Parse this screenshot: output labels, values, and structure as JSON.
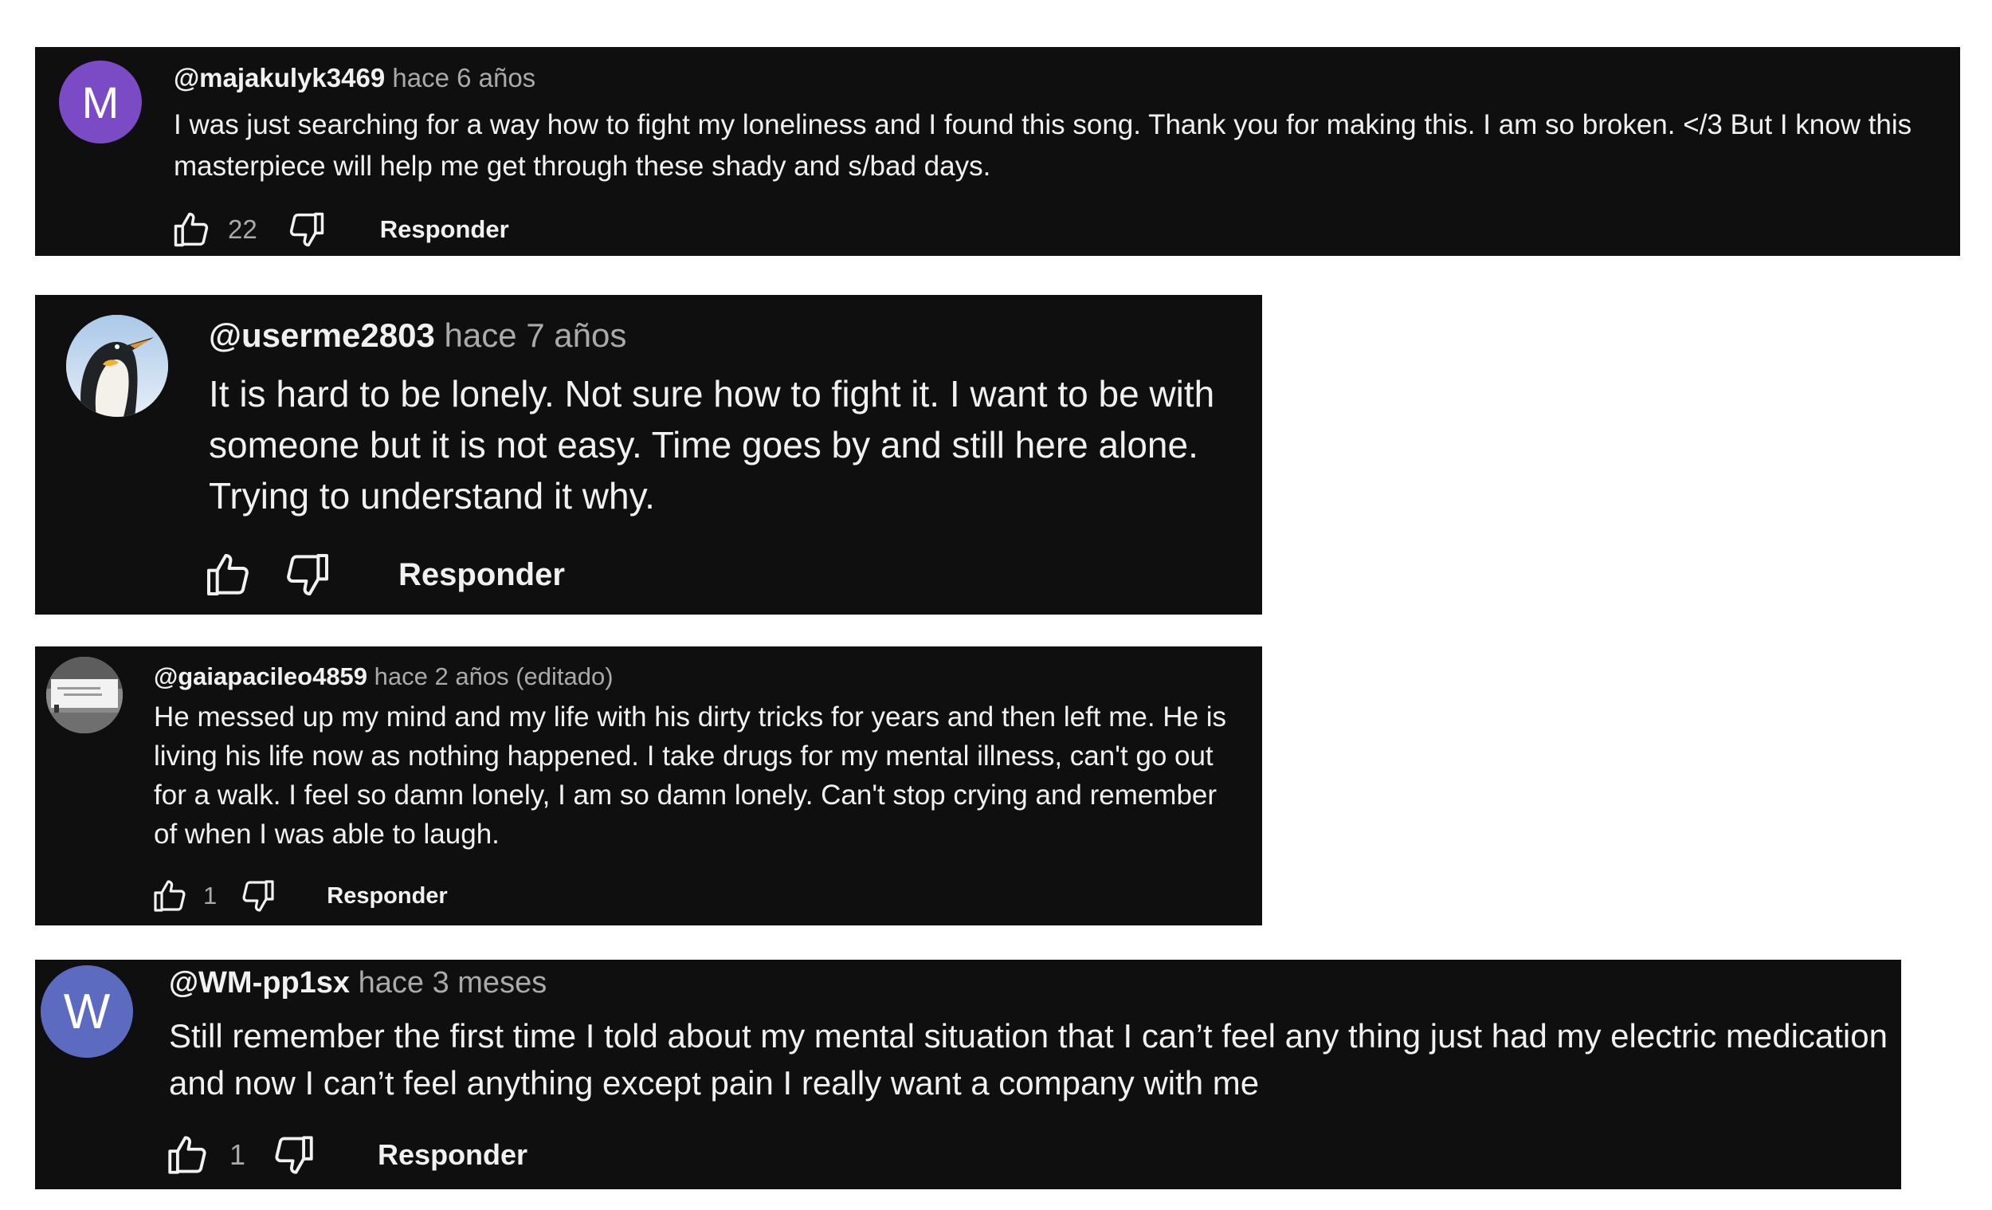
{
  "comments": [
    {
      "avatar_letter": "M",
      "avatar_color": "#7b4bc6",
      "author": "@majakulyk3469",
      "time": "hace 6 años",
      "text": "I was just searching for a way how to fight my loneliness and I found this song. Thank you for making this. I am so broken. </3 But I know this masterpiece will help me get through these shady and s/bad days.",
      "likes": "22",
      "reply_label": "Responder"
    },
    {
      "avatar_icon": "penguin-avatar",
      "author": "@userme2803",
      "time": "hace 7 años",
      "text": "It is hard to be lonely. Not sure how to fight it. I want to be with someone but it is not easy. Time goes by and still here alone. Trying to understand it why.",
      "reply_label": "Responder"
    },
    {
      "avatar_icon": "photo-avatar",
      "author": "@gaiapacileo4859",
      "time": "hace 2 años (editado)",
      "text": "He messed up my mind and my life with his dirty tricks for years and then left me. He is living his life now as nothing happened. I take drugs for my mental illness, can't go out for a walk. I feel so damn lonely, I am so damn lonely. Can't stop crying and remember of when I was able to laugh.",
      "likes": "1",
      "reply_label": "Responder"
    },
    {
      "avatar_letter": "W",
      "avatar_color": "#5c6bc0",
      "author": "@WM-pp1sx",
      "time": "hace 3 meses",
      "text": "Still remember the first time I told about my mental situation that I can’t feel any thing just had my electric medication and now I can’t feel anything except pain I really want a company with me",
      "likes": "1",
      "reply_label": "Responder"
    }
  ]
}
